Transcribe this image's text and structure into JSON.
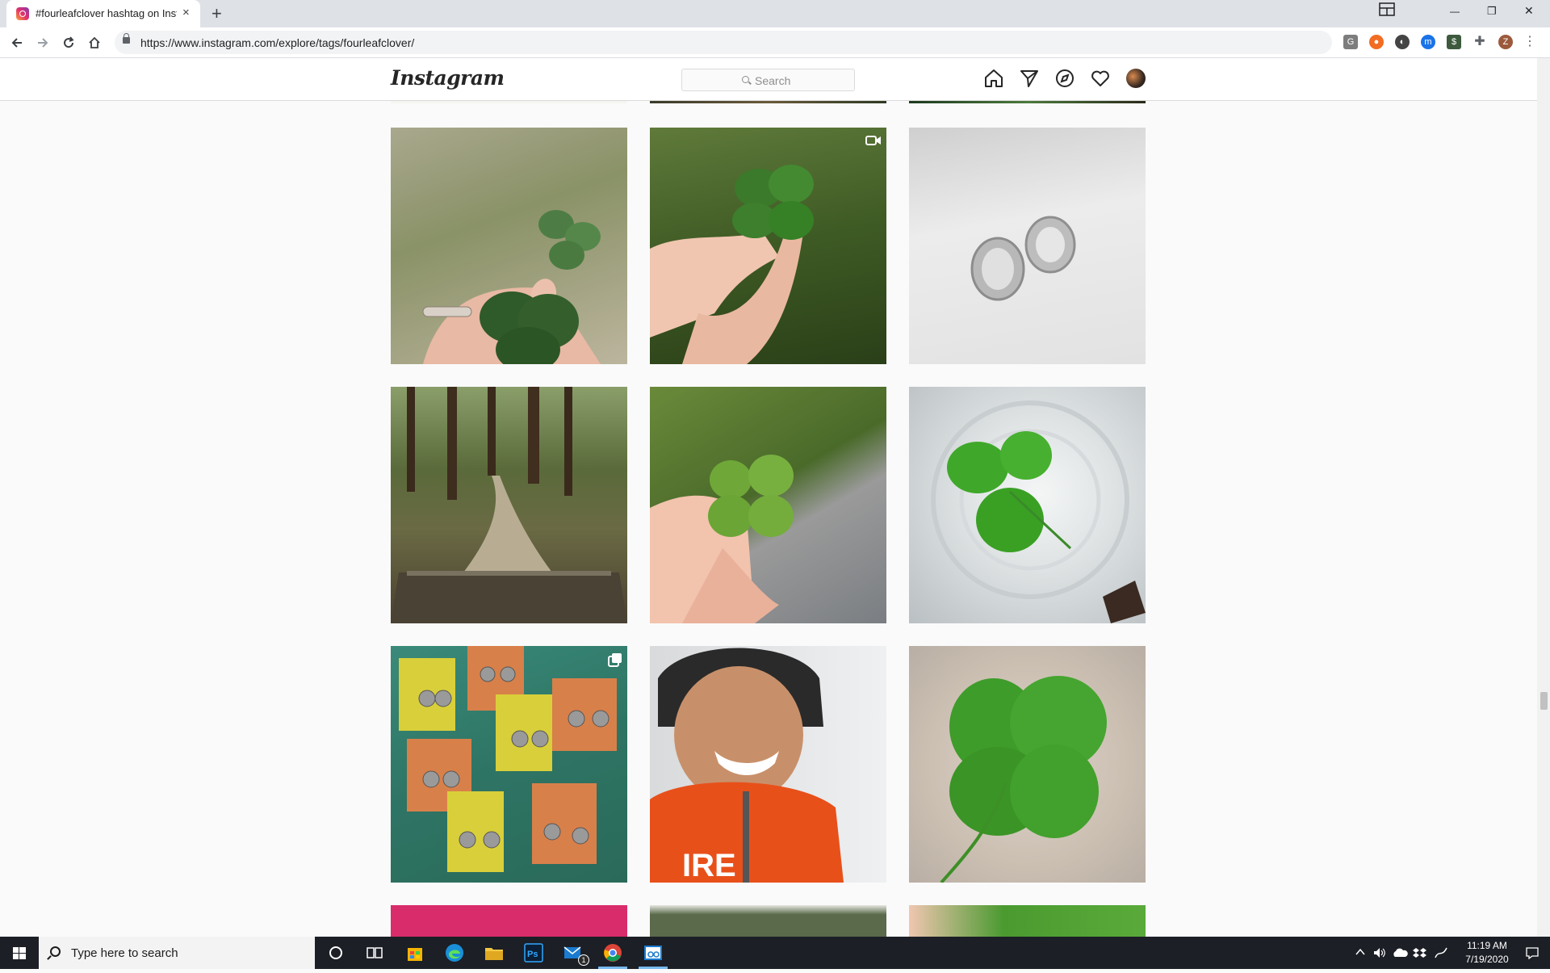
{
  "browser": {
    "tab_title": "#fourleafclover hashtag on Instagram",
    "tab_close": "×",
    "new_tab": "+",
    "url": "https://www.instagram.com/explore/tags/fourleafclover/",
    "profile_initial": "Z",
    "window_controls": {
      "minimize": "—",
      "maximize": "❐",
      "close": "✕"
    }
  },
  "instagram": {
    "logo": "Instagram",
    "search_placeholder": "Search",
    "nav_icons": [
      "home-icon",
      "direct-icon",
      "explore-icon",
      "activity-icon",
      "profile-avatar"
    ],
    "posts": [
      {
        "id": "p1",
        "desc": "hand with ring holding two clovers",
        "badge": ""
      },
      {
        "id": "p2",
        "desc": "fingers holding four-leaf clover on grass",
        "badge": "video"
      },
      {
        "id": "p3",
        "desc": "silver rings with clover stamp",
        "badge": ""
      },
      {
        "id": "p4",
        "desc": "forest path between trees",
        "badge": ""
      },
      {
        "id": "p5",
        "desc": "hand holding four-leaf clover",
        "badge": ""
      },
      {
        "id": "p6",
        "desc": "clover in glass of water",
        "badge": ""
      },
      {
        "id": "p7",
        "desc": "clover earrings on cards",
        "badge": "carousel"
      },
      {
        "id": "p8",
        "desc": "smiling child in orange hoodie",
        "badge": ""
      },
      {
        "id": "p9",
        "desc": "large four-leaf clover",
        "badge": ""
      }
    ]
  },
  "taskbar": {
    "search_placeholder": "Type here to search",
    "mail_badge": "1",
    "time": "11:19 AM",
    "date": "7/19/2020"
  },
  "colors": {
    "page_bg": "#fafafa",
    "border": "#dbdbdb",
    "taskbar": "#1c1f26"
  }
}
